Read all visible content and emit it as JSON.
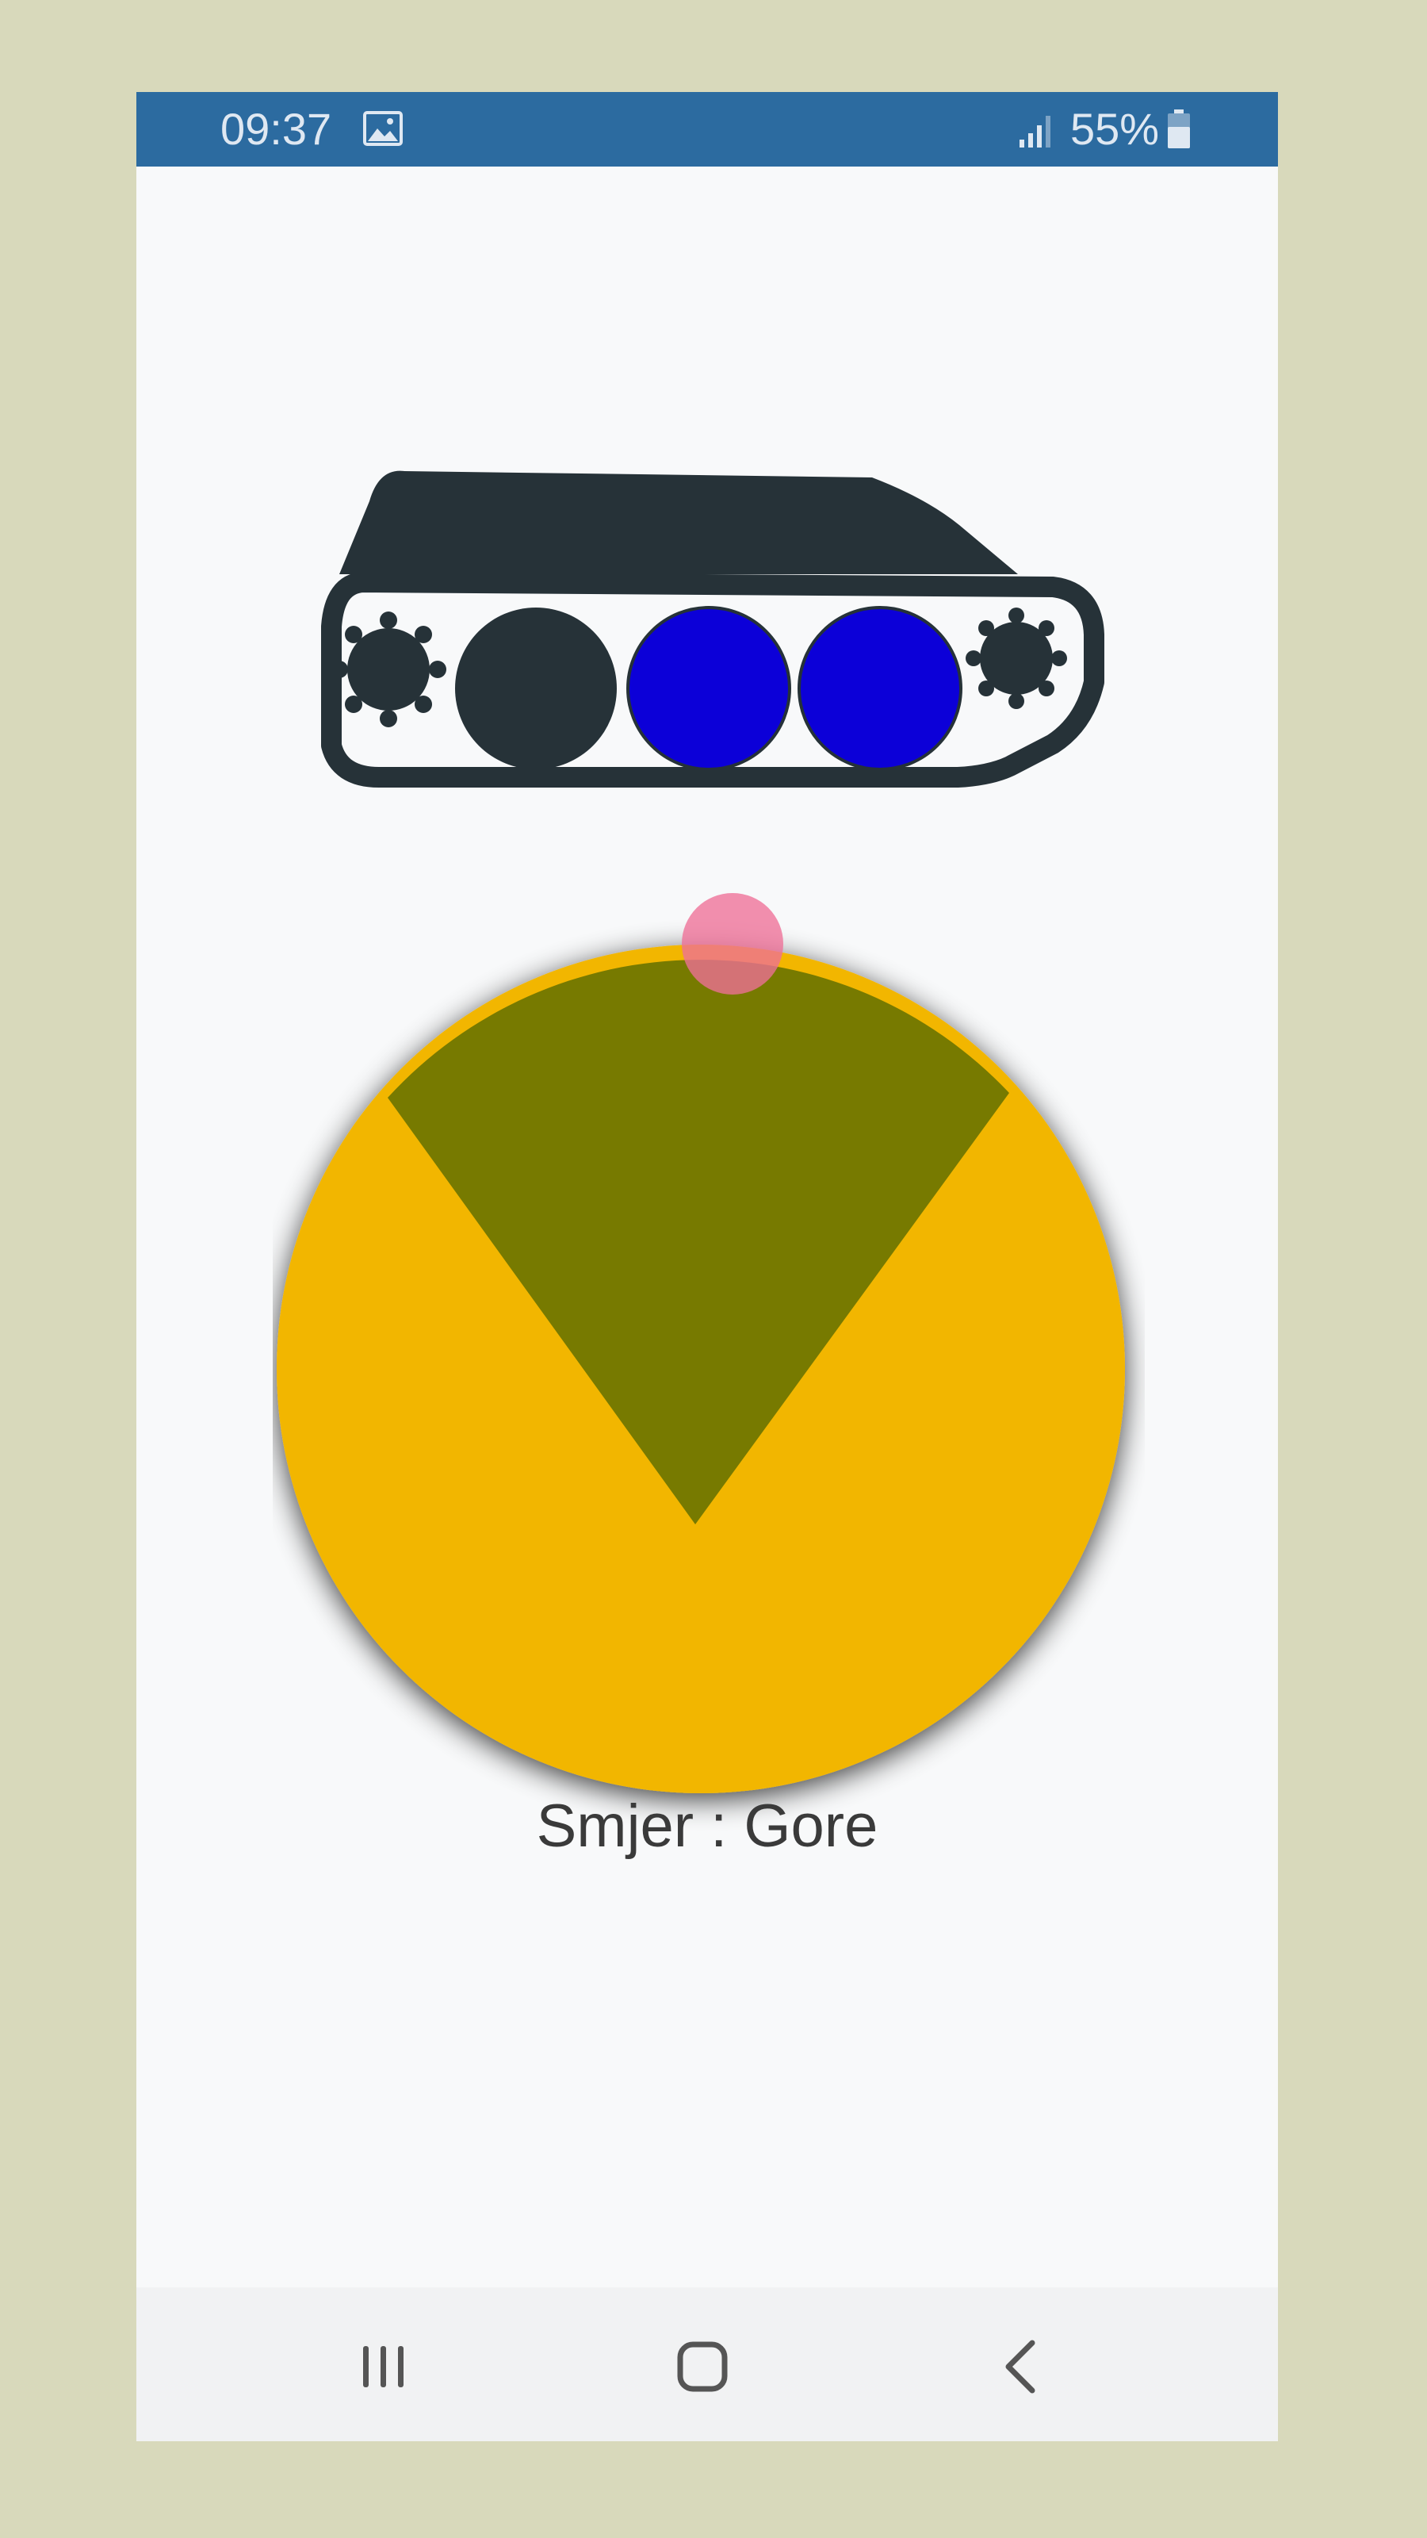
{
  "status_bar": {
    "time": "09:37",
    "battery": "55%",
    "icons": [
      "gallery-icon",
      "signal-icon",
      "battery-icon"
    ],
    "color": "#2c6ba0"
  },
  "tank": {
    "icon": "tank-icon",
    "body_color": "#263238",
    "wheel_colors": [
      "#263238",
      "#0c00d8",
      "#0c00d8"
    ]
  },
  "joystick": {
    "base_color": "#f2b600",
    "active_sector_color": "#777a00",
    "knob_color": "#ee6f97",
    "active_direction": "up"
  },
  "direction_label": "Smjer : Gore",
  "nav_bar": {
    "buttons": [
      "recent-apps-icon",
      "home-icon",
      "back-icon"
    ]
  }
}
